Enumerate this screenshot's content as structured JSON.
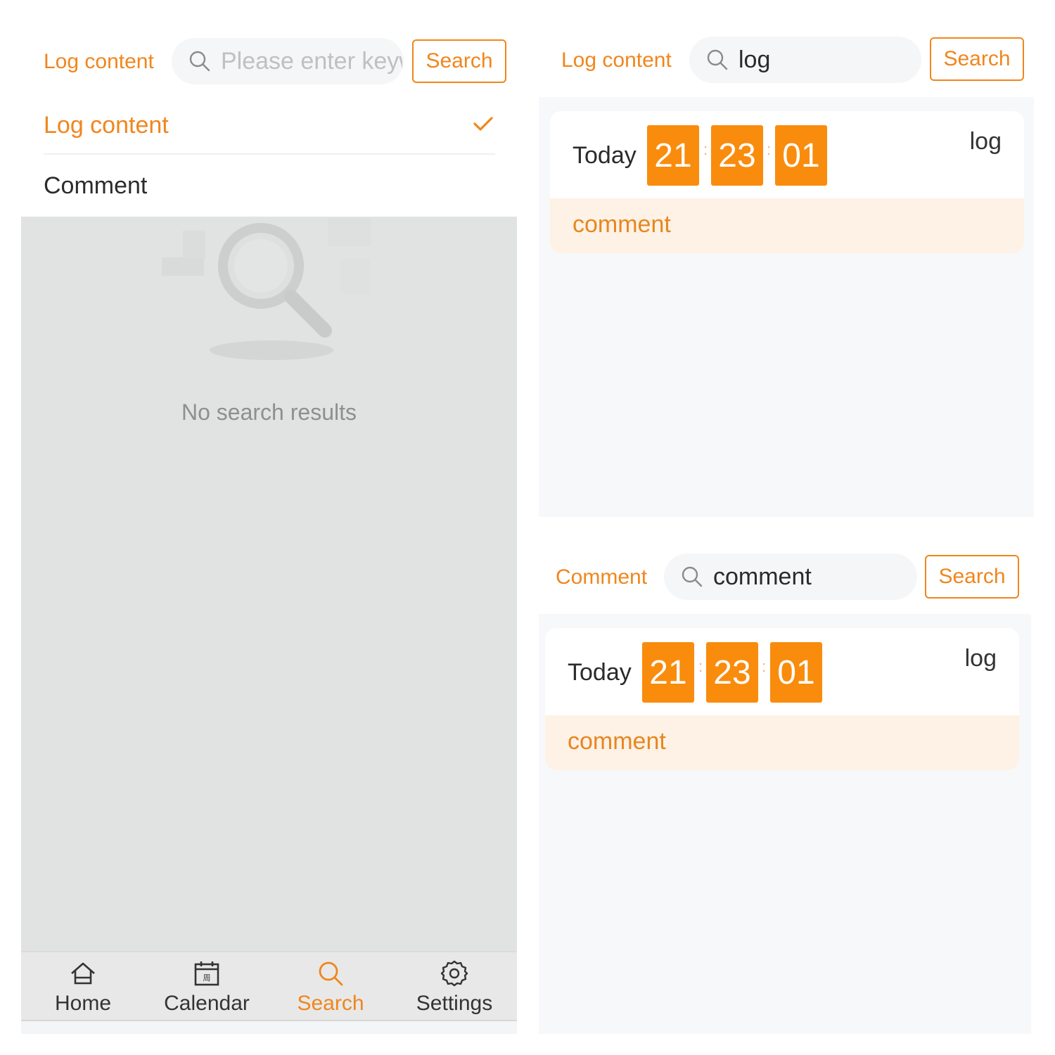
{
  "left_panel": {
    "scope_label": "Log content",
    "search_placeholder": "Please enter keyword",
    "search_button": "Search",
    "dropdown": {
      "items": [
        {
          "label": "Log content",
          "selected": true
        },
        {
          "label": "Comment",
          "selected": false
        }
      ]
    },
    "empty_state": {
      "text": "No search results"
    },
    "tabbar": {
      "tabs": [
        {
          "label": "Home",
          "icon": "home-icon"
        },
        {
          "label": "Calendar",
          "icon": "calendar-icon",
          "icon_glyph": "周"
        },
        {
          "label": "Search",
          "icon": "search-icon",
          "active": true
        },
        {
          "label": "Settings",
          "icon": "gear-icon"
        }
      ]
    }
  },
  "top_right_panel": {
    "scope_label": "Log content",
    "search_value": "log",
    "search_button": "Search",
    "result": {
      "day": "Today",
      "hour": "21",
      "minute": "23",
      "second": "01",
      "tag": "log",
      "comment": "comment"
    }
  },
  "bottom_right_panel": {
    "scope_label": "Comment",
    "search_value": "comment",
    "search_button": "Search",
    "result": {
      "day": "Today",
      "hour": "21",
      "minute": "23",
      "second": "01",
      "tag": "log",
      "comment": "comment"
    }
  },
  "colors": {
    "accent": "#f0861d",
    "digit_bg": "#f98c0d",
    "comment_bg": "#fef2e6",
    "overlay": "#e1e2e2"
  }
}
